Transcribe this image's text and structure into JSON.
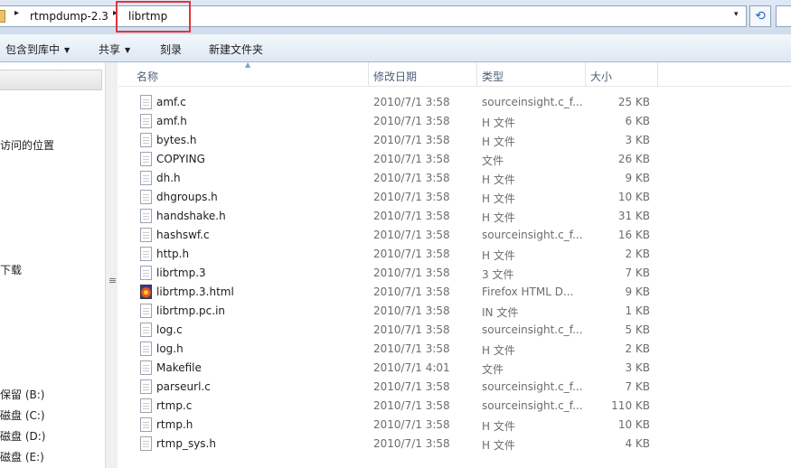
{
  "address": {
    "crumbs": [
      "rtmpdump-2.3",
      "librtmp"
    ],
    "separator": "▸",
    "dropdown": "▾",
    "refresh_glyph": "⟲"
  },
  "toolbar": {
    "items": [
      "包含到库中",
      "共享",
      "刻录",
      "新建文件夹"
    ],
    "dropdown_arrow": "▼"
  },
  "nav": {
    "items": [
      "访问的位置",
      "下载",
      "保留 (B:)",
      "磁盘 (C:)",
      "磁盘 (D:)",
      "磁盘 (E:)"
    ],
    "grip_glyph": "≡"
  },
  "headers": {
    "name": "名称",
    "date": "修改日期",
    "type": "类型",
    "size": "大小",
    "sort_glyph": "▲"
  },
  "files": [
    {
      "name": "amf.c",
      "date": "2010/7/1 3:58",
      "type": "sourceinsight.c_f...",
      "size": "25 KB",
      "icon": "document-icon"
    },
    {
      "name": "amf.h",
      "date": "2010/7/1 3:58",
      "type": "H 文件",
      "size": "6 KB",
      "icon": "document-icon"
    },
    {
      "name": "bytes.h",
      "date": "2010/7/1 3:58",
      "type": "H 文件",
      "size": "3 KB",
      "icon": "document-icon"
    },
    {
      "name": "COPYING",
      "date": "2010/7/1 3:58",
      "type": "文件",
      "size": "26 KB",
      "icon": "document-icon"
    },
    {
      "name": "dh.h",
      "date": "2010/7/1 3:58",
      "type": "H 文件",
      "size": "9 KB",
      "icon": "document-icon"
    },
    {
      "name": "dhgroups.h",
      "date": "2010/7/1 3:58",
      "type": "H 文件",
      "size": "10 KB",
      "icon": "document-icon"
    },
    {
      "name": "handshake.h",
      "date": "2010/7/1 3:58",
      "type": "H 文件",
      "size": "31 KB",
      "icon": "document-icon"
    },
    {
      "name": "hashswf.c",
      "date": "2010/7/1 3:58",
      "type": "sourceinsight.c_f...",
      "size": "16 KB",
      "icon": "document-icon"
    },
    {
      "name": "http.h",
      "date": "2010/7/1 3:58",
      "type": "H 文件",
      "size": "2 KB",
      "icon": "document-icon"
    },
    {
      "name": "librtmp.3",
      "date": "2010/7/1 3:58",
      "type": "3 文件",
      "size": "7 KB",
      "icon": "document-icon"
    },
    {
      "name": "librtmp.3.html",
      "date": "2010/7/1 3:58",
      "type": "Firefox HTML D...",
      "size": "9 KB",
      "icon": "firefox-icon"
    },
    {
      "name": "librtmp.pc.in",
      "date": "2010/7/1 3:58",
      "type": "IN 文件",
      "size": "1 KB",
      "icon": "document-icon"
    },
    {
      "name": "log.c",
      "date": "2010/7/1 3:58",
      "type": "sourceinsight.c_f...",
      "size": "5 KB",
      "icon": "document-icon"
    },
    {
      "name": "log.h",
      "date": "2010/7/1 3:58",
      "type": "H 文件",
      "size": "2 KB",
      "icon": "document-icon"
    },
    {
      "name": "Makefile",
      "date": "2010/7/1 4:01",
      "type": "文件",
      "size": "3 KB",
      "icon": "document-icon"
    },
    {
      "name": "parseurl.c",
      "date": "2010/7/1 3:58",
      "type": "sourceinsight.c_f...",
      "size": "7 KB",
      "icon": "document-icon"
    },
    {
      "name": "rtmp.c",
      "date": "2010/7/1 3:58",
      "type": "sourceinsight.c_f...",
      "size": "110 KB",
      "icon": "document-icon"
    },
    {
      "name": "rtmp.h",
      "date": "2010/7/1 3:58",
      "type": "H 文件",
      "size": "10 KB",
      "icon": "document-icon"
    },
    {
      "name": "rtmp_sys.h",
      "date": "2010/7/1 3:58",
      "type": "H 文件",
      "size": "4 KB",
      "icon": "document-icon"
    }
  ],
  "colors": {
    "highlight_box": "#e0343b",
    "header_text": "#4c607a"
  }
}
